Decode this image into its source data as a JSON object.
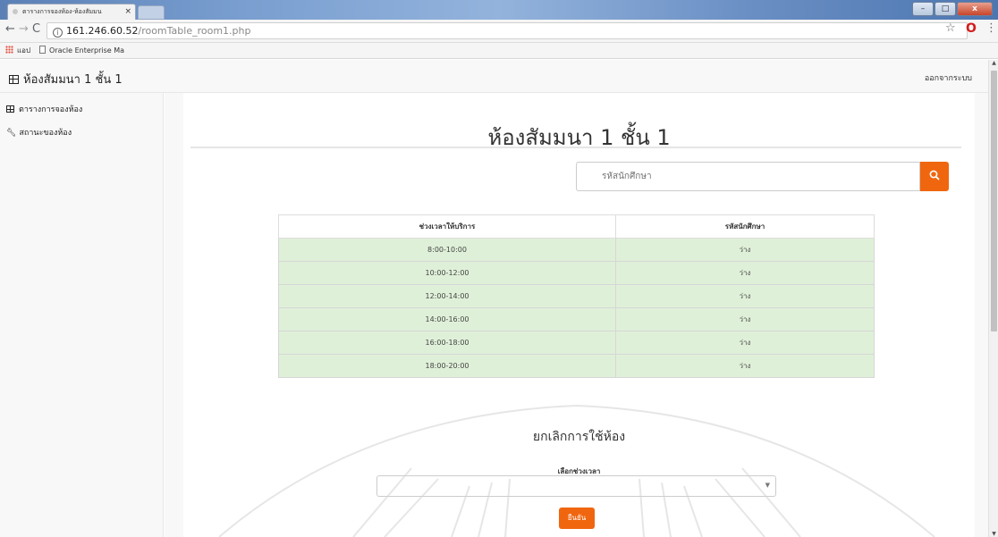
{
  "browser": {
    "tab_title": "ตารางการจองห้อง-ห้องสัมมน",
    "tab_close": "×",
    "url_host": "161.246.60.52",
    "url_path": "/roomTable_room1.php",
    "bookmarks": [
      {
        "label": "แอป",
        "icon": "apps-grid-icon"
      },
      {
        "label": "Oracle Enterprise Ma",
        "icon": "page-icon"
      }
    ]
  },
  "navbar": {
    "brand": "ห้องสัมมนา 1 ชั้น 1",
    "logout": "ออกจากระบบ"
  },
  "sidebar": {
    "items": [
      {
        "label": "ตารางการจองห้อง",
        "icon": "table-grid-icon"
      },
      {
        "label": "สถานะของห้อง",
        "icon": "wrench-icon"
      }
    ]
  },
  "main": {
    "title": "ห้องสัมมนา 1 ชั้น 1",
    "search_placeholder": "รหัสนักศึกษา",
    "table": {
      "headers": [
        "ช่วงเวลาให้บริการ",
        "รหัสนักศึกษา"
      ],
      "rows": [
        [
          "8:00-10:00",
          "ว่าง"
        ],
        [
          "10:00-12:00",
          "ว่าง"
        ],
        [
          "12:00-14:00",
          "ว่าง"
        ],
        [
          "14:00-16:00",
          "ว่าง"
        ],
        [
          "16:00-18:00",
          "ว่าง"
        ],
        [
          "18:00-20:00",
          "ว่าง"
        ]
      ]
    },
    "cancel_title": "ยกเลิกการใช้ห้อง",
    "select_label": "เลือกช่วงเวลา",
    "select_value": "",
    "confirm_button": "ยืนยัน"
  },
  "colors": {
    "accent": "#f0660f",
    "row_available": "#dff0d8",
    "nav_bg": "#f8f8f8"
  }
}
